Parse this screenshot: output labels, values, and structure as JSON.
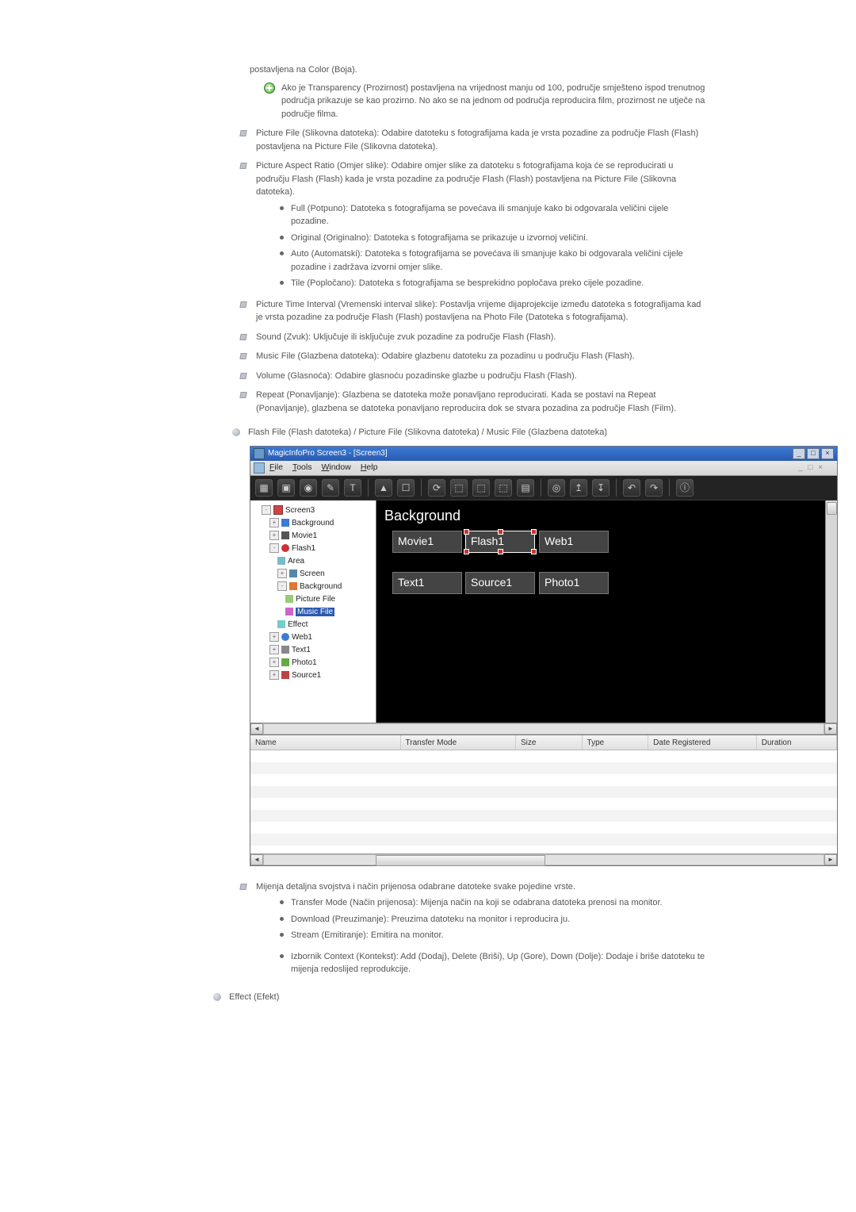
{
  "intro": "postavljena na Color (Boja).",
  "note1": "Ako je Transparency (Prozirnost) postavljena na vrijednost manju od 100, područje smješteno ispod trenutnog područja prikazuje se kao prozirno. No ako se na jednom od područja reproducira film, prozirnost ne utječe na područje filma.",
  "items": {
    "pictureFile": "Picture File (Slikovna datoteka): Odabire datoteku s fotografijama kada je vrsta pozadine za područje Flash (Flash) postavljena na Picture File (Slikovna datoteka).",
    "aspect": "Picture Aspect Ratio (Omjer slike): Odabire omjer slike za datoteku s fotografijama koja će se reproducirati u području Flash (Flash) kada je vrsta pozadine za područje Flash (Flash) postavljena na Picture File (Slikovna datoteka).",
    "aspectSub": {
      "full": "Full (Potpuno): Datoteka s fotografijama se povećava ili smanjuje kako bi odgovarala veličini cijele pozadine.",
      "original": "Original (Originalno): Datoteka s fotografijama se prikazuje u izvornoj veličini.",
      "auto": "Auto (Automatski): Datoteka s fotografijama se povećava ili smanjuje kako bi odgovarala veličini cijele pozadine i zadržava izvorni omjer slike.",
      "tile": "Tile (Popločano): Datoteka s fotografijama se besprekidno popločava preko cijele pozadine."
    },
    "timeInterval": "Picture Time Interval (Vremenski interval slike): Postavlja vrijeme dijaprojekcije između datoteka s fotografijama kad je vrsta pozadine za područje Flash (Flash) postavljena na Photo File (Datoteka s fotografijama).",
    "sound": "Sound (Zvuk): Uključuje ili isključuje zvuk pozadine za područje Flash (Flash).",
    "musicFile": "Music File (Glazbena datoteka): Odabire glazbenu datoteku za pozadinu u području Flash (Flash).",
    "volume": "Volume (Glasnoća): Odabire glasnoću pozadinske glazbe u području Flash (Flash).",
    "repeat": "Repeat (Ponavljanje): Glazbena se datoteka može ponavljano reproducirati. Kada se postavi na Repeat (Ponavljanje), glazbena se datoteka ponavljano reproducira dok se stvara pozadina za područje Flash (Film)."
  },
  "sectionFlash": "Flash File (Flash datoteka) / Picture File (Slikovna datoteka) / Music File (Glazbena datoteka)",
  "screenshot": {
    "title": "MagicInfoPro Screen3 - [Screen3]",
    "menu": {
      "file": "File",
      "tools": "Tools",
      "window": "Window",
      "help": "Help"
    },
    "toolbar": [
      "▦",
      "▣",
      "◉",
      "✎",
      "T",
      "▲",
      "☐",
      "⟳",
      "⬚",
      "⬚",
      "⬚",
      "▤",
      "◎",
      "↥",
      "↧",
      "↶",
      "↷",
      "ⓘ"
    ],
    "tree": {
      "root": "Screen3",
      "n": {
        "background": "Background",
        "movie1": "Movie1",
        "flash1": "Flash1",
        "area": "Area",
        "screen": "Screen",
        "bg2": "Background",
        "pictureFile": "Picture File",
        "musicFile": "Music File",
        "effect": "Effect",
        "web1": "Web1",
        "text1": "Text1",
        "photo1": "Photo1",
        "source1": "Source1"
      }
    },
    "canvas": {
      "title": "Background",
      "slots": {
        "movie1": "Movie1",
        "flash1": "Flash1",
        "web1": "Web1",
        "text1": "Text1",
        "source1": "Source1",
        "photo1": "Photo1"
      }
    },
    "table": {
      "cols": {
        "name": "Name",
        "transfer": "Transfer Mode",
        "size": "Size",
        "type": "Type",
        "date": "Date Registered",
        "duration": "Duration"
      }
    }
  },
  "afterImg": {
    "main": "Mijenja detaljna svojstva i način prijenosa odabrane datoteke svake pojedine vrste.",
    "sub": {
      "transfer": "Transfer Mode (Način prijenosa): Mijenja način na koji se odabrana datoteka prenosi na monitor.",
      "download": "Download (Preuzimanje): Preuzima datoteku na monitor i reproducira ju.",
      "stream": "Stream (Emitiranje): Emitira na monitor.",
      "context": "Izbornik Context (Kontekst): Add (Dodaj), Delete (Briši), Up (Gore), Down (Dolje): Dodaje i briše datoteku te mijenja redoslijed reprodukcije."
    }
  },
  "effectHeading": "Effect (Efekt)"
}
